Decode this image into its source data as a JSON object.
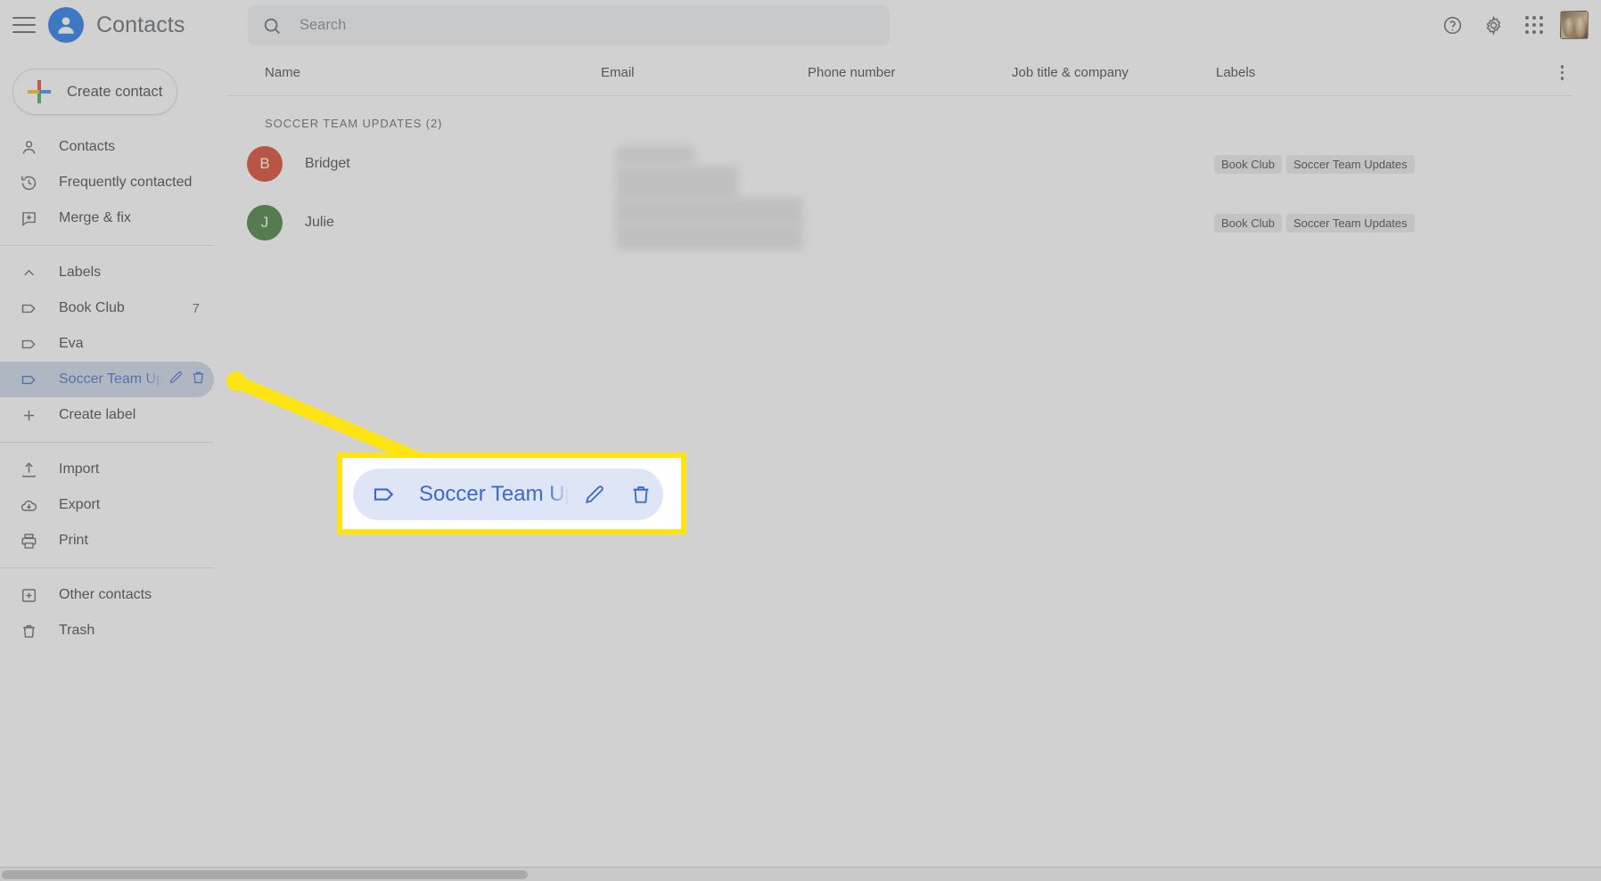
{
  "app": {
    "title": "Contacts",
    "logo_icon": "person-avatar-icon",
    "menu_icon": "hamburger-menu-icon"
  },
  "search": {
    "placeholder": "Search",
    "icon": "search-icon"
  },
  "topbar_actions": [
    {
      "name": "help-icon",
      "label": "Help"
    },
    {
      "name": "gear-icon",
      "label": "Settings"
    },
    {
      "name": "apps-grid-icon",
      "label": "Google apps"
    },
    {
      "name": "account-avatar",
      "label": "Google Account"
    }
  ],
  "sidebar": {
    "create_contact": {
      "label": "Create contact",
      "icon": "plus-icon"
    },
    "items": [
      {
        "label": "Contacts",
        "icon": "person-icon",
        "count": ""
      },
      {
        "label": "Frequently contacted",
        "icon": "history-clock-icon",
        "count": ""
      },
      {
        "label": "Merge & fix",
        "icon": "merge-fix-icon",
        "count": ""
      }
    ],
    "labels_header": {
      "label": "Labels",
      "icon": "chevron-up-icon"
    },
    "labels": [
      {
        "label": "Book Club",
        "icon": "label-tag-icon",
        "count": "7",
        "selected": false
      },
      {
        "label": "Eva",
        "icon": "label-tag-icon",
        "count": "",
        "selected": false
      },
      {
        "label": "Soccer Team Updates",
        "icon": "label-tag-icon",
        "count": "",
        "selected": true
      }
    ],
    "create_label": {
      "label": "Create label",
      "icon": "plus-icon"
    },
    "tools": [
      {
        "label": "Import",
        "icon": "import-upload-icon"
      },
      {
        "label": "Export",
        "icon": "export-cloud-download-icon"
      },
      {
        "label": "Print",
        "icon": "printer-icon"
      }
    ],
    "footer": [
      {
        "label": "Other contacts",
        "icon": "other-contacts-icon"
      },
      {
        "label": "Trash",
        "icon": "trash-icon"
      }
    ],
    "row_actions": [
      {
        "name": "edit-label-icon",
        "label": "Rename label"
      },
      {
        "name": "delete-label-icon",
        "label": "Delete label"
      }
    ]
  },
  "table": {
    "columns": [
      "Name",
      "Email",
      "Phone number",
      "Job title & company",
      "Labels"
    ],
    "more_options_icon": "more-vertical-icon",
    "section_header": "SOCCER TEAM UPDATES (2)",
    "rows": [
      {
        "name": "Bridget",
        "initial": "B",
        "avatar_color": "#d93f21",
        "email": "",
        "phone": "",
        "job": "",
        "labels": [
          "Book Club",
          "Soccer Team Updates"
        ]
      },
      {
        "name": "Julie",
        "initial": "J",
        "avatar_color": "#3c7a32",
        "email": "",
        "phone": "",
        "job": "",
        "labels": [
          "Book Club",
          "Soccer Team Updates"
        ]
      }
    ]
  },
  "callout": {
    "highlight_color": "#ffe414",
    "magnified_label": "Soccer Team Updates",
    "magnified_tag_icon": "label-tag-icon",
    "magnified_edit_icon": "edit-pencil-icon",
    "magnified_delete_icon": "trash-icon"
  }
}
